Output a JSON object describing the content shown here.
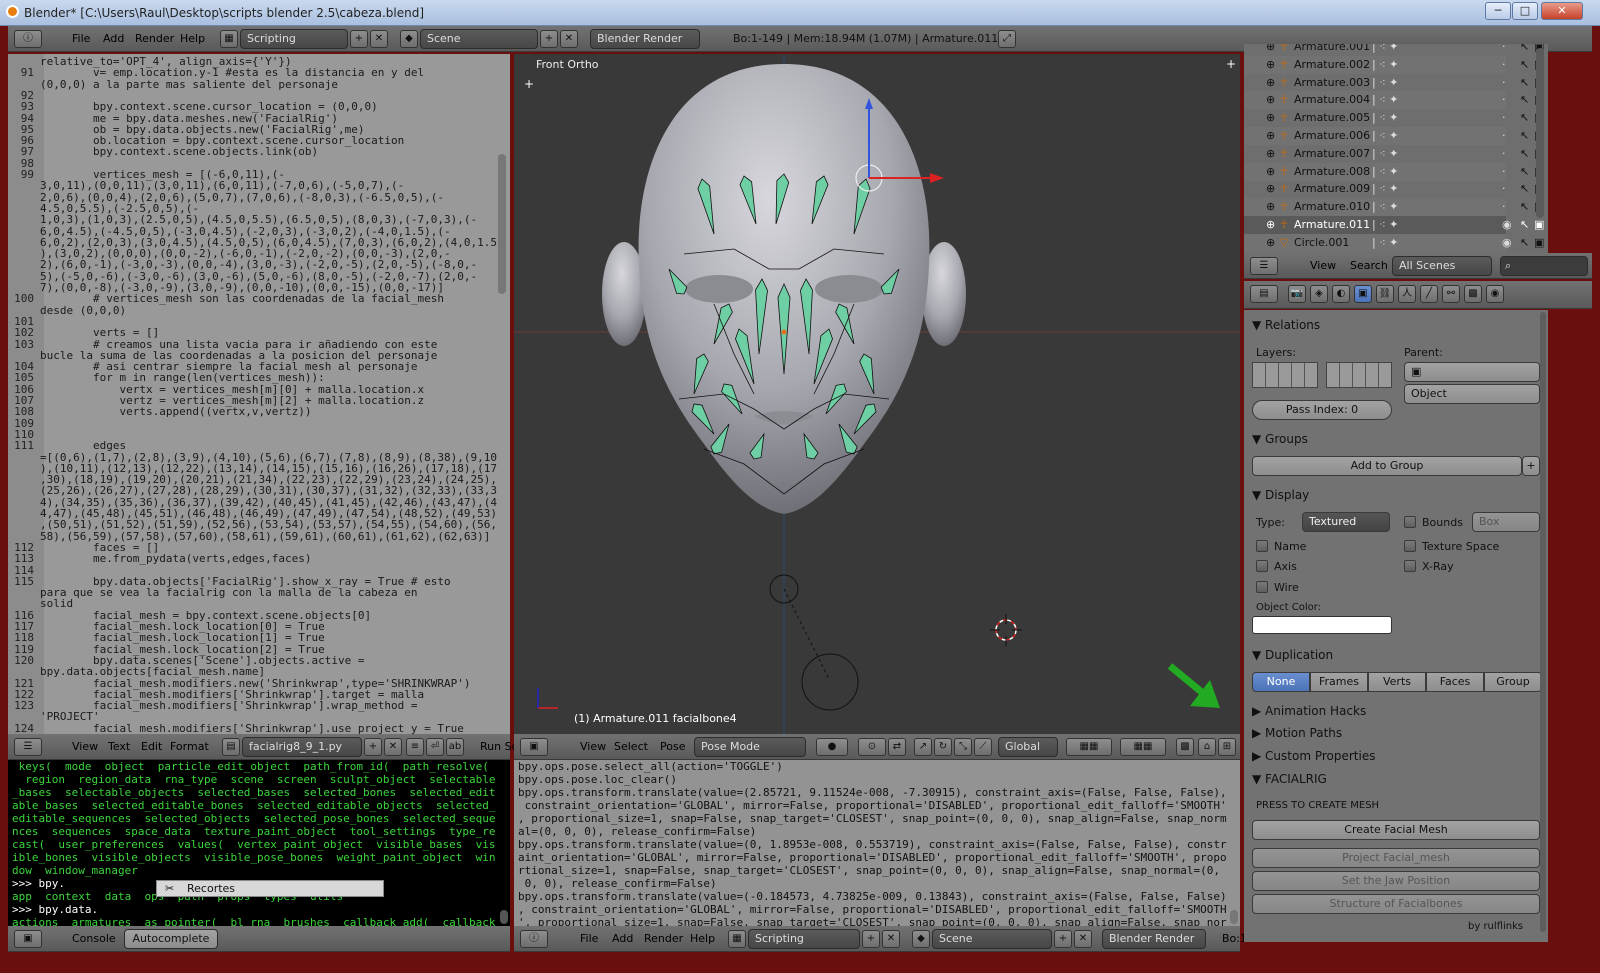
{
  "window": {
    "title": "Blender* [C:\\Users\\Raul\\Desktop\\scripts blender 2.5\\cabeza.blend]",
    "minimize": "─",
    "maximize": "□",
    "close": "✕"
  },
  "topbar": {
    "menus": [
      "File",
      "Add",
      "Render",
      "Help"
    ],
    "screen_layout": "Scripting",
    "scene": "Scene",
    "engine": "Blender Render",
    "stats": "Bo:1-149  |  Mem:18.94M (1.07M)  |  Armature.011"
  },
  "text_editor": {
    "lines": [
      {
        "n": "",
        "t": "relative_to='OPT_4', align_axis={'Y'})"
      },
      {
        "n": "91",
        "t": "        v= emp.location.y-1 #esta es la distancia en y del"
      },
      {
        "n": "",
        "t": "(0,0,0) a la parte mas saliente del personaje"
      },
      {
        "n": "92",
        "t": ""
      },
      {
        "n": "93",
        "t": "        bpy.context.scene.cursor_location = (0,0,0)"
      },
      {
        "n": "94",
        "t": "        me = bpy.data.meshes.new('FacialRig')"
      },
      {
        "n": "95",
        "t": "        ob = bpy.data.objects.new('FacialRig',me)"
      },
      {
        "n": "96",
        "t": "        ob.location = bpy.context.scene.cursor_location"
      },
      {
        "n": "97",
        "t": "        bpy.context.scene.objects.link(ob)"
      },
      {
        "n": "98",
        "t": ""
      },
      {
        "n": "99",
        "t": "        vertices_mesh = [(-6,0,11),(-"
      },
      {
        "n": "",
        "t": "3,0,11),(0,0,11),(3,0,11),(6,0,11),(-7,0,6),(-5,0,7),(-"
      },
      {
        "n": "",
        "t": "2,0,6),(0,0,4),(2,0,6),(5,0,7),(7,0,6),(-8,0,3),(-6.5,0,5),(-"
      },
      {
        "n": "",
        "t": "4.5,0,5.5),(-2.5,0,5),(-"
      },
      {
        "n": "",
        "t": "1,0,3),(1,0,3),(2.5,0,5),(4.5,0,5.5),(6.5,0,5),(8,0,3),(-7,0,3),(-"
      },
      {
        "n": "",
        "t": "6,0,4.5),(-4.5,0,5),(-3,0,4.5),(-2,0,3),(-3,0,2),(-4,0,1.5),(-"
      },
      {
        "n": "",
        "t": "6,0,2),(2,0,3),(3,0,4.5),(4.5,0,5),(6,0,4.5),(7,0,3),(6,0,2),(4,0,1.5"
      },
      {
        "n": "",
        "t": "),(3,0,2),(0,0,0),(0,0,-2),(-6,0,-1),(-2,0,-2),(0,0,-3),(2,0,-"
      },
      {
        "n": "",
        "t": "2),(6,0,-1),(-3,0,-3),(0,0,-4),(3,0,-3),(-2,0,-5),(2,0,-5),(-8,0,-"
      },
      {
        "n": "",
        "t": "5),(-5,0,-6),(-3,0,-6),(3,0,-6),(5,0,-6),(8,0,-5),(-2,0,-7),(2,0,-"
      },
      {
        "n": "",
        "t": "7),(0,0,-8),(-3,0,-9),(3,0,-9),(0,0,-10),(0,0,-15),(0,0,-17)]"
      },
      {
        "n": "100",
        "t": "        # vertices_mesh son las coordenadas de la facial_mesh"
      },
      {
        "n": "",
        "t": "desde (0,0,0)"
      },
      {
        "n": "101",
        "t": ""
      },
      {
        "n": "102",
        "t": "        verts = []"
      },
      {
        "n": "103",
        "t": "        # creamos una lista vacia para ir añadiendo con este"
      },
      {
        "n": "",
        "t": "bucle la suma de las coordenadas a la posicion del personaje"
      },
      {
        "n": "104",
        "t": "        # asi centrar siempre la facial mesh al personaje"
      },
      {
        "n": "105",
        "t": "        for m in range(len(vertices_mesh)):"
      },
      {
        "n": "106",
        "t": "            vertx = vertices_mesh[m][0] + malla.location.x"
      },
      {
        "n": "107",
        "t": "            vertz = vertices_mesh[m][2] + malla.location.z"
      },
      {
        "n": "108",
        "t": "            verts.append((vertx,v,vertz))"
      },
      {
        "n": "109",
        "t": ""
      },
      {
        "n": "110",
        "t": ""
      },
      {
        "n": "111",
        "t": "        edges"
      },
      {
        "n": "",
        "t": "=[(0,6),(1,7),(2,8),(3,9),(4,10),(5,6),(6,7),(7,8),(8,9),(8,38),(9,10"
      },
      {
        "n": "",
        "t": "),(10,11),(12,13),(12,22),(13,14),(14,15),(15,16),(16,26),(17,18),(17"
      },
      {
        "n": "",
        "t": ",30),(18,19),(19,20),(20,21),(21,34),(22,23),(22,29),(23,24),(24,25),"
      },
      {
        "n": "",
        "t": "(25,26),(26,27),(27,28),(28,29),(30,31),(30,37),(31,32),(32,33),(33,3"
      },
      {
        "n": "",
        "t": "4),(34,35),(35,36),(36,37),(39,42),(40,45),(41,45),(42,46),(43,47),(4"
      },
      {
        "n": "",
        "t": "4,47),(45,48),(45,51),(46,48),(46,49),(47,49),(47,54),(48,52),(49,53)"
      },
      {
        "n": "",
        "t": ",(50,51),(51,52),(51,59),(52,56),(53,54),(53,57),(54,55),(54,60),(56,"
      },
      {
        "n": "",
        "t": "58),(56,59),(57,58),(57,60),(58,61),(59,61),(60,61),(61,62),(62,63)]"
      },
      {
        "n": "112",
        "t": "        faces = []"
      },
      {
        "n": "113",
        "t": "        me.from_pydata(verts,edges,faces)"
      },
      {
        "n": "114",
        "t": ""
      },
      {
        "n": "115",
        "t": "        bpy.data.objects['FacialRig'].show_x_ray = True # esto"
      },
      {
        "n": "",
        "t": "para que se vea la facialrig con la malla de la cabeza en"
      },
      {
        "n": "",
        "t": "solid"
      },
      {
        "n": "116",
        "t": "        facial_mesh = bpy.context.scene.objects[0]"
      },
      {
        "n": "117",
        "t": "        facial_mesh.lock_location[0] = True"
      },
      {
        "n": "118",
        "t": "        facial_mesh.lock_location[1] = True"
      },
      {
        "n": "119",
        "t": "        facial_mesh.lock_location[2] = True"
      },
      {
        "n": "120",
        "t": "        bpy.data.scenes['Scene'].objects.active ="
      },
      {
        "n": "",
        "t": "bpy.data.objects[facial_mesh.name]"
      },
      {
        "n": "121",
        "t": "        facial_mesh.modifiers.new('Shrinkwrap',type='SHRINKWRAP')"
      },
      {
        "n": "122",
        "t": "        facial_mesh.modifiers['Shrinkwrap'].target = malla"
      },
      {
        "n": "123",
        "t": "        facial_mesh.modifiers['Shrinkwrap'].wrap_method ="
      },
      {
        "n": "",
        "t": "'PROJECT'"
      },
      {
        "n": "124",
        "t": "        facial_mesh.modifiers['Shrinkwrap'].use_project_y = True"
      }
    ],
    "header": {
      "menus": [
        "View",
        "Text",
        "Edit",
        "Format"
      ],
      "filename": "facialrig8_9_1.py",
      "run": "Run Sc"
    }
  },
  "console": {
    "lines": [
      " keys(  mode  object  particle_edit_object  path_from_id(  path_resolve(",
      "  region  region_data  rna_type  scene  screen  sculpt_object  selectable",
      "_bases  selectable_objects  selected_bases  selected_bones  selected_edit",
      "able_bases  selected_editable_bones  selected_editable_objects  selected_",
      "editable_sequences  selected_objects  selected_pose_bones  selected_seque",
      "nces  sequences  space_data  texture_paint_object  tool_settings  type_re",
      "cast(  user_preferences  values(  vertex_paint_object  visible_bases  vis",
      "ible_bones  visible_objects  visible_pose_bones  weight_paint_object  win",
      "dow  window_manager",
      ">>> bpy.",
      "app  context  data  ops  path  props  types  utils",
      ">>> bpy.data.",
      "actions  armatures  as_pointer(  bl_rna  brushes  callback_add(  callback"
    ],
    "tooltip": "Recortes",
    "header": {
      "tabs": [
        "Console",
        "Autocomplete"
      ]
    }
  },
  "viewport": {
    "label": "Front Ortho",
    "status": "(1) Armature.011 facialbone4",
    "header": {
      "menus": [
        "View",
        "Select",
        "Pose"
      ],
      "mode": "Pose Mode",
      "orientation": "Global"
    }
  },
  "info": {
    "lines": [
      "bpy.ops.pose.select_all(action='TOGGLE')",
      "bpy.ops.pose.loc_clear()",
      "bpy.ops.transform.translate(value=(2.85721, 9.11524e-008, -7.30915), constraint_axis=(False, False, False),",
      " constraint_orientation='GLOBAL', mirror=False, proportional='DISABLED', proportional_edit_falloff='SMOOTH'",
      ", proportional_size=1, snap=False, snap_target='CLOSEST', snap_point=(0, 0, 0), snap_align=False, snap_norm",
      "al=(0, 0, 0), release_confirm=False)",
      "bpy.ops.transform.translate(value=(0, 1.8953e-008, 0.553719), constraint_axis=(False, False, False), constr",
      "aint_orientation='GLOBAL', mirror=False, proportional='DISABLED', proportional_edit_falloff='SMOOTH', propo",
      "rtional_size=1, snap=False, snap_target='CLOSEST', snap_point=(0, 0, 0), snap_align=False, snap_normal=(0,",
      " 0, 0), release_confirm=False)",
      "bpy.ops.transform.translate(value=(-0.184573, 4.73825e-009, 0.13843), constraint_axis=(False, False, False)",
      ", constraint_orientation='GLOBAL', mirror=False, proportional='DISABLED', proportional_edit_falloff='SMOOTH",
      "', proportional_size=1, snap=False, snap_target='CLOSEST', snap_point=(0, 0, 0), snap_align=False, snap_nor"
    ],
    "header": {
      "menus": [
        "File",
        "Add",
        "Render",
        "Help"
      ],
      "screen_layout": "Scripting",
      "scene": "Scene",
      "engine": "Blender Render",
      "stats": "Bo:1"
    }
  },
  "outliner": {
    "rows": [
      {
        "name": "Armature.001",
        "selected": false
      },
      {
        "name": "Armature.002",
        "selected": false
      },
      {
        "name": "Armature.003",
        "selected": false
      },
      {
        "name": "Armature.004",
        "selected": false
      },
      {
        "name": "Armature.005",
        "selected": false
      },
      {
        "name": "Armature.006",
        "selected": false
      },
      {
        "name": "Armature.007",
        "selected": false
      },
      {
        "name": "Armature.008",
        "selected": false
      },
      {
        "name": "Armature.009",
        "selected": false
      },
      {
        "name": "Armature.010",
        "selected": false
      },
      {
        "name": "Armature.011",
        "selected": true
      },
      {
        "name": "Circle.001",
        "selected": false
      }
    ],
    "header": {
      "menus": [
        "View",
        "Search"
      ],
      "filter": "All Scenes"
    }
  },
  "properties": {
    "relations": {
      "title": "Relations",
      "layers": "Layers:",
      "parent": "Parent:",
      "parent_type": "Object",
      "pass_index": "Pass Index: 0"
    },
    "groups": {
      "title": "Groups",
      "add": "Add to Group"
    },
    "display": {
      "title": "Display",
      "type_label": "Type:",
      "type": "Textured",
      "bounds": "Bounds",
      "bounds_type": "Box",
      "name": "Name",
      "texture_space": "Texture Space",
      "axis": "Axis",
      "xray": "X-Ray",
      "wire": "Wire",
      "object_color": "Object Color:"
    },
    "duplication": {
      "title": "Duplication",
      "tabs": [
        "None",
        "Frames",
        "Verts",
        "Faces",
        "Group"
      ]
    },
    "collapsed": [
      "Animation Hacks",
      "Motion Paths",
      "Custom Properties"
    ],
    "facialrig": {
      "title": "FACIALRIG",
      "press": "PRESS TO CREATE MESH",
      "buttons": [
        "Create Facial Mesh",
        "Project Facial_mesh",
        "Set the Jaw Position",
        "Structure of Facialbones"
      ],
      "credit": "by rulflinks"
    }
  }
}
